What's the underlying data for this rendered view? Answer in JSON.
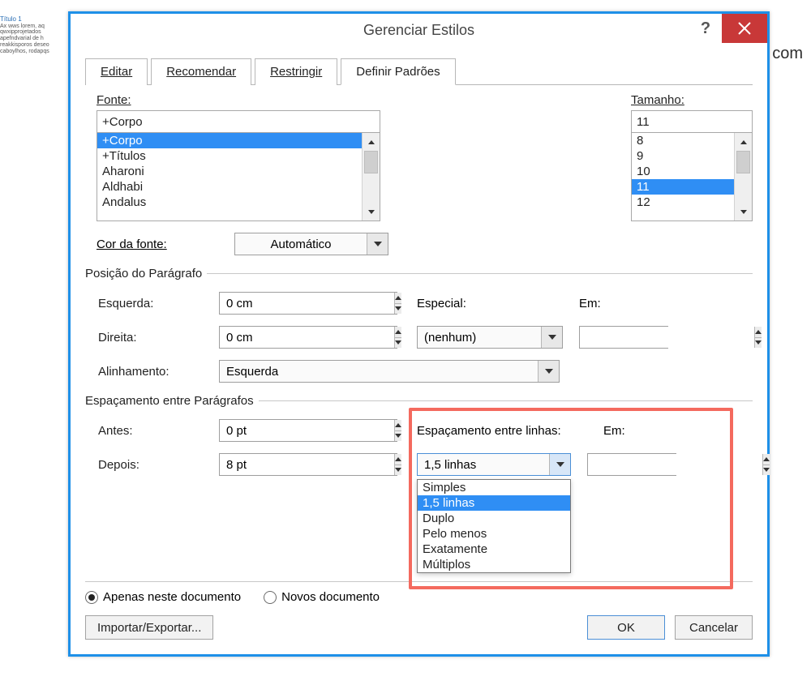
{
  "dialog": {
    "title": "Gerenciar Estilos",
    "help": "?"
  },
  "tabs": {
    "items": [
      "Editar",
      "Recomendar",
      "Restringir",
      "Definir Padrões"
    ],
    "active": 3
  },
  "font": {
    "label": "Fonte:",
    "value": "+Corpo",
    "options": [
      "+Corpo",
      "+Títulos",
      "Aharoni",
      "Aldhabi",
      "Andalus"
    ],
    "selected": 0
  },
  "size": {
    "label": "Tamanho:",
    "value": "11",
    "options": [
      "8",
      "9",
      "10",
      "11",
      "12"
    ],
    "selected": 3
  },
  "fontcolor": {
    "label": "Cor da fonte:",
    "value": "Automático"
  },
  "paragraphPosition": {
    "legend": "Posição do Parágrafo",
    "left_label": "Esquerda:",
    "left_value": "0 cm",
    "right_label": "Direita:",
    "right_value": "0 cm",
    "align_label": "Alinhamento:",
    "align_value": "Esquerda",
    "special_label": "Especial:",
    "special_value": "(nenhum)",
    "em_label": "Em:",
    "em_value": ""
  },
  "paragraphSpacing": {
    "legend": "Espaçamento entre Parágrafos",
    "before_label": "Antes:",
    "before_value": "0 pt",
    "after_label": "Depois:",
    "after_value": "8 pt",
    "linespacing_label": "Espaçamento entre linhas:",
    "linespacing_value": "1,5 linhas",
    "linespacing_options": [
      "Simples",
      "1,5 linhas",
      "Duplo",
      "Pelo menos",
      "Exatamente",
      "Múltiplos"
    ],
    "linespacing_selected": 1,
    "em_label": "Em:",
    "em_value": ""
  },
  "footer": {
    "radio1": "Apenas neste documento",
    "radio2": "Novos documento",
    "radio_selected": 0,
    "import": "Importar/Exportar...",
    "ok": "OK",
    "cancel": "Cancelar"
  },
  "bg": {
    "rightlabel": "ir com"
  }
}
